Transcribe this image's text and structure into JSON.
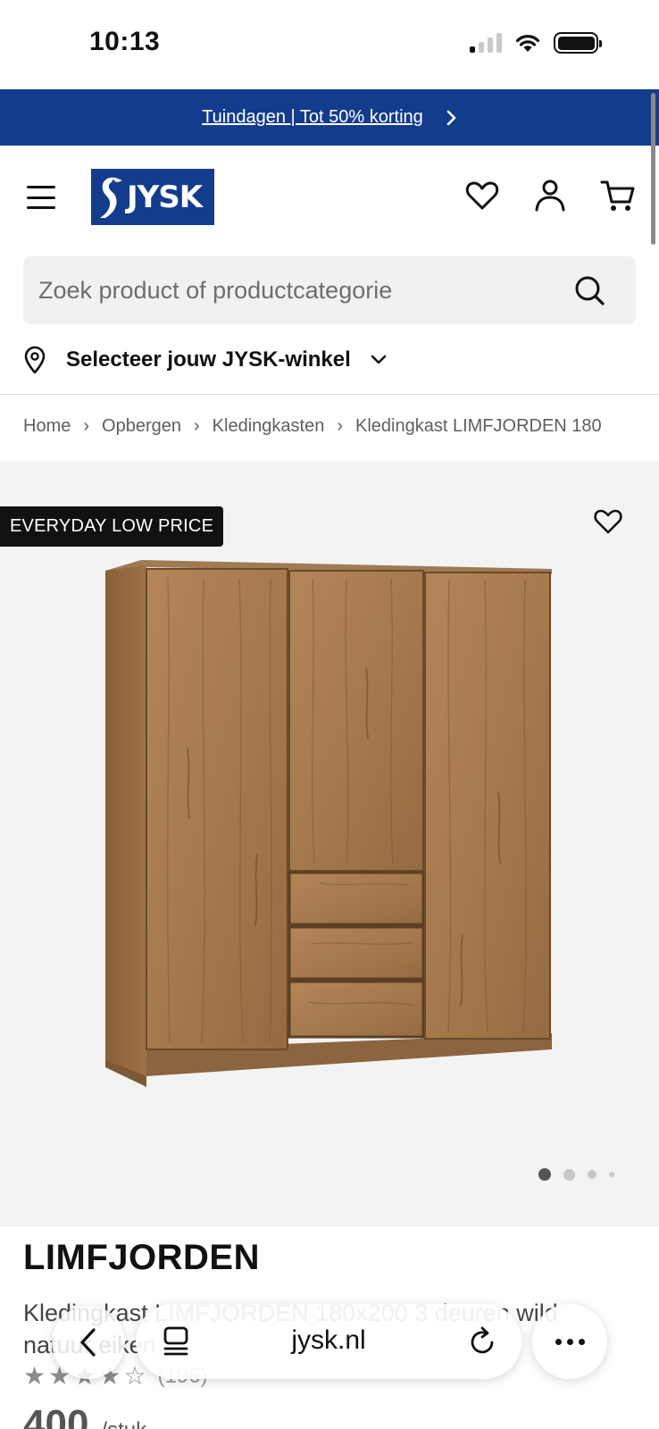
{
  "status_bar": {
    "time": "10:13"
  },
  "promo_banner": {
    "text": "Tuindagen | Tot 50% korting"
  },
  "header": {
    "logo_text": "JYSK"
  },
  "search": {
    "placeholder": "Zoek product of productcategorie"
  },
  "store_selector": {
    "label": "Selecteer jouw JYSK-winkel"
  },
  "breadcrumb": {
    "items": [
      "Home",
      "Opbergen",
      "Kledingkasten",
      "Kledingkast LIMFJORDEN 180"
    ]
  },
  "gallery": {
    "badge": "EVERYDAY LOW PRICE",
    "active_image_index": 0,
    "image_count": 4
  },
  "product": {
    "title": "LIMFJORDEN",
    "description": "Kledingkast LIMFJORDEN 180x200 3 deuren wild natuur eiken",
    "rating": 4.5,
    "review_count": "(196)",
    "price": "400",
    "price_unit": "/stuk"
  },
  "browser_toolbar": {
    "url": "jysk.nl"
  },
  "colors": {
    "brand_blue": "#143c8c",
    "badge_black": "#111111",
    "gallery_bg": "#f3f3f3",
    "wood": "#a77a4f"
  }
}
